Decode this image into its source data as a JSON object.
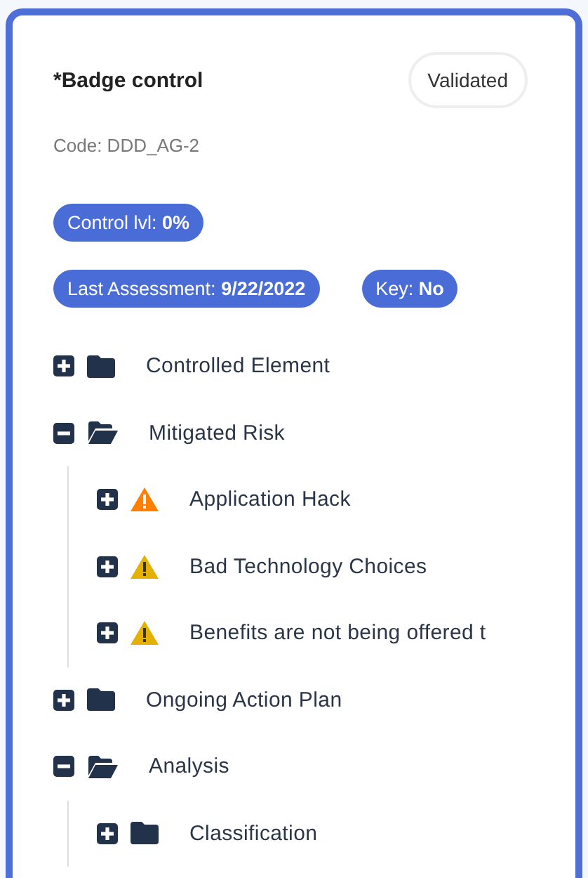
{
  "card": {
    "title": "*Badge control",
    "status": "Validated",
    "code": "Code: DDD_AG-2",
    "badge_rows": [
      [
        "Control lvl: **0%**"
      ],
      [
        "Last Assessment: **9/22/2022**",
        "Key: **No**"
      ]
    ],
    "tree": [
      {
        "kind": "folder",
        "label": "Controlled Element",
        "expanded": false
      },
      {
        "kind": "folder",
        "label": "Mitigated Risk",
        "expanded": true,
        "children": [
          {
            "kind": "risk",
            "label": "Application Hack",
            "expanded": false,
            "color": "#ff8000"
          },
          {
            "kind": "risk",
            "label": "Bad Technology Choices",
            "expanded": false,
            "color": "#e6b000"
          },
          {
            "kind": "risk",
            "label": "Benefits are not being offered t",
            "expanded": false,
            "color": "#e6b000"
          }
        ]
      },
      {
        "kind": "folder",
        "label": "Ongoing Action Plan",
        "expanded": false
      },
      {
        "kind": "folder",
        "label": "Analysis",
        "expanded": true,
        "children": [
          {
            "kind": "folder",
            "label": "Classification",
            "expanded": false
          }
        ]
      }
    ]
  }
}
